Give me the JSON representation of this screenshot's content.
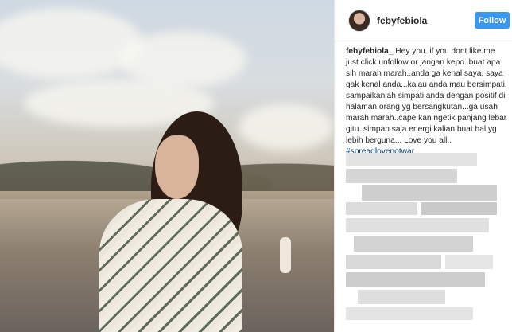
{
  "post": {
    "username": "febyfebiola_",
    "follow_label": "Follow",
    "caption_author": "febyfebiola_",
    "caption_text": "Hey you..if you dont like me just click unfollow or jangan kepo..buat apa sih marah marah..anda ga kenal saya, saya gak kenal anda...kalau anda mau bersimpati, sampaikanlah simpati anda dengan positif di halaman orang yg bersangkutan...ga usah marah marah..cape kan ngetik panjang lebar gitu..simpan saja energi kalian buat hal yg lebih berguna... Love you all..",
    "hashtag": "#spreadlovenotwar"
  },
  "colors": {
    "follow_button": "#3897f0",
    "hashtag": "#003569",
    "text": "#262626"
  }
}
